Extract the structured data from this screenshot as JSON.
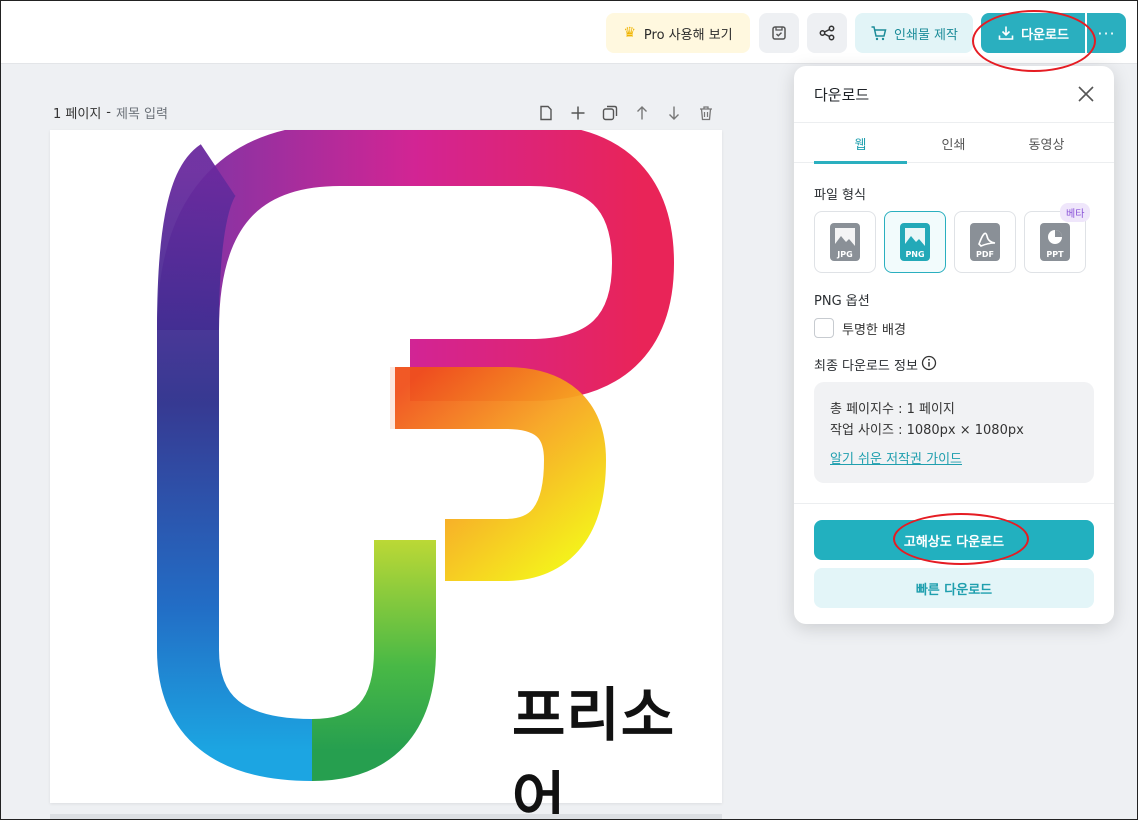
{
  "topbar": {
    "pro_label": "Pro 사용해 보기",
    "print_label": "인쇄물 제작",
    "download_label": "다운로드",
    "more_label": "···"
  },
  "page": {
    "number_label": "1 페이지",
    "separator": "-",
    "title_placeholder": "제목 입력",
    "brand_text": "프리소어"
  },
  "panel": {
    "title": "다운로드",
    "tabs": [
      {
        "label": "웹",
        "active": true
      },
      {
        "label": "인쇄",
        "active": false
      },
      {
        "label": "동영상",
        "active": false
      }
    ],
    "file_format_label": "파일 형식",
    "formats": [
      {
        "label": "JPG",
        "selected": false
      },
      {
        "label": "PNG",
        "selected": true
      },
      {
        "label": "PDF",
        "selected": false
      },
      {
        "label": "PPT",
        "selected": false,
        "badge": "베타"
      }
    ],
    "png_options_label": "PNG 옵션",
    "transparent_bg_label": "투명한 배경",
    "transparent_bg_checked": false,
    "final_info_label": "최종 다운로드 정보",
    "info": {
      "pages": "총 페이지수 : 1 페이지",
      "size": "작업 사이즈 : 1080px × 1080px",
      "copyright_link": "알기 쉬운 저작권 가이드"
    },
    "hq_download_label": "고해상도 다운로드",
    "quick_download_label": "빠른 다운로드"
  },
  "colors": {
    "accent": "#2aafbf",
    "annotation_red": "#e51c23"
  }
}
